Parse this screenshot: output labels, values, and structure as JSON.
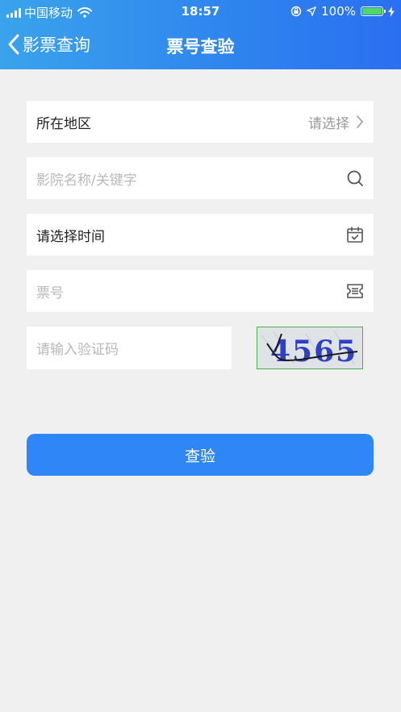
{
  "status": {
    "carrier": "中国移动",
    "time": "18:57",
    "battery_percent": "100%"
  },
  "nav": {
    "back_label": "影票查询",
    "title": "票号查验"
  },
  "form": {
    "region": {
      "label": "所在地区",
      "value": "请选择"
    },
    "cinema": {
      "placeholder": "影院名称/关键字"
    },
    "time": {
      "label": "请选择时间"
    },
    "ticket": {
      "placeholder": "票号"
    },
    "captcha": {
      "placeholder": "请输入验证码",
      "code": "4565"
    }
  },
  "submit_label": "查验",
  "colors": {
    "header_start": "#3aa3ec",
    "header_end": "#2a6ff0",
    "button": "#2f86f6",
    "background": "#f0f0f0"
  },
  "icons": [
    "chevron-left-icon",
    "chevron-right-icon",
    "search-icon",
    "calendar-icon",
    "ticket-icon",
    "wifi-icon",
    "battery-icon"
  ]
}
